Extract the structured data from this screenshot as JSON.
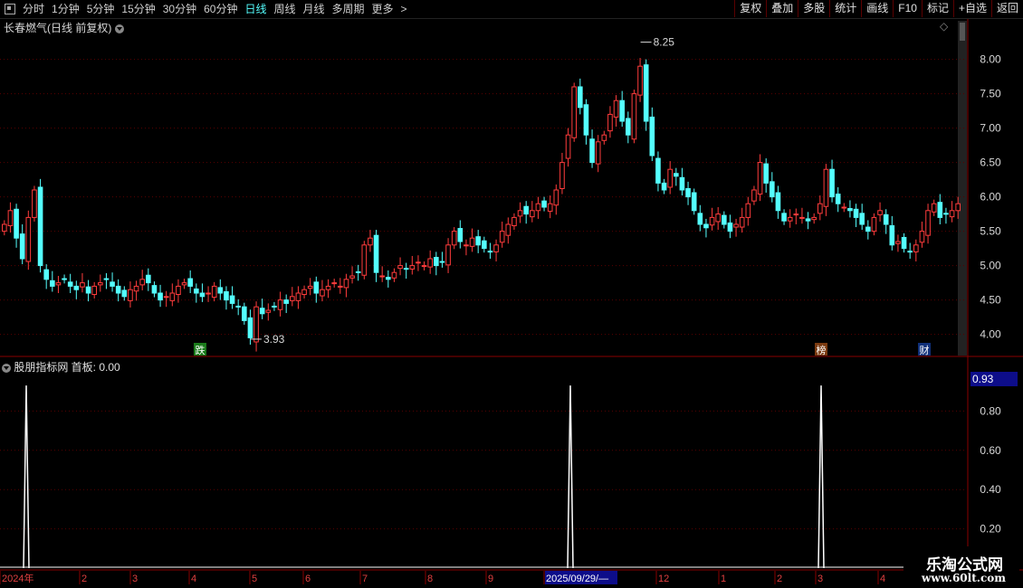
{
  "toolbar": {
    "periods": [
      "分时",
      "1分钟",
      "5分钟",
      "15分钟",
      "30分钟",
      "60分钟",
      "日线",
      "周线",
      "月线",
      "多周期",
      "更多"
    ],
    "active_period": "日线",
    "more_arrow": ">",
    "buttons": [
      "复权",
      "叠加",
      "多股",
      "统计",
      "画线",
      "F10",
      "标记",
      "+自选",
      "返回"
    ]
  },
  "main_panel": {
    "title": "长春燃气(日线 前复权)",
    "diamond_icon": "◇"
  },
  "indicator_panel": {
    "title": "股朋指标网 首板: 0.00",
    "current_axis_value": "0.93"
  },
  "price_axis": {
    "ticks": [
      "8.00",
      "7.50",
      "7.00",
      "6.50",
      "6.00",
      "5.50",
      "5.00",
      "4.50",
      "4.00"
    ]
  },
  "indicator_axis": {
    "ticks": [
      "0.80",
      "0.60",
      "0.40",
      "0.20"
    ]
  },
  "annotations": {
    "high": "8.25",
    "low": "3.93"
  },
  "markers": [
    "跌",
    "榜",
    "财"
  ],
  "time_axis": {
    "labels": [
      "2024年",
      "2",
      "3",
      "4",
      "5",
      "6",
      "7",
      "8",
      "9",
      "2025/09/29/—",
      "12",
      "1",
      "2",
      "3",
      "4"
    ],
    "highlighted": "2025/09/29/—"
  },
  "watermark": {
    "title": "乐淘公式网",
    "url": "www.60lt.com"
  },
  "colors": {
    "up": "#ff3c3c",
    "down": "#54ffff",
    "grid": "#5a0000",
    "signal": "#ffffff",
    "axis_highlight": "#0d0d8a"
  },
  "chart_data": {
    "type": "candlestick",
    "series_type": "close",
    "ylim": [
      3.85,
      8.35
    ],
    "high": 8.25,
    "low": 3.93,
    "closes": [
      5.6,
      5.8,
      5.4,
      5.1,
      5.7,
      6.1,
      5.0,
      4.8,
      4.7,
      4.75,
      4.8,
      4.7,
      4.65,
      4.75,
      4.6,
      4.7,
      4.75,
      4.8,
      4.7,
      4.6,
      4.55,
      4.65,
      4.7,
      4.8,
      4.75,
      4.6,
      4.5,
      4.55,
      4.6,
      4.7,
      4.75,
      4.7,
      4.6,
      4.55,
      4.6,
      4.7,
      4.6,
      4.5,
      4.45,
      4.4,
      4.2,
      3.95,
      4.4,
      4.3,
      4.35,
      4.4,
      4.5,
      4.45,
      4.55,
      4.6,
      4.65,
      4.7,
      4.6,
      4.65,
      4.7,
      4.75,
      4.7,
      4.8,
      4.85,
      4.9,
      5.3,
      5.4,
      4.9,
      4.85,
      4.8,
      4.9,
      5.0,
      4.95,
      5.0,
      5.05,
      5.0,
      5.1,
      5.0,
      5.05,
      5.3,
      5.5,
      5.35,
      5.3,
      5.4,
      5.3,
      5.25,
      5.2,
      5.3,
      5.5,
      5.6,
      5.7,
      5.8,
      5.75,
      5.8,
      5.9,
      5.85,
      5.9,
      6.1,
      6.5,
      6.9,
      7.6,
      7.3,
      6.9,
      6.5,
      6.8,
      6.9,
      7.2,
      7.4,
      7.1,
      6.9,
      7.5,
      7.9,
      7.1,
      6.6,
      6.2,
      6.1,
      6.4,
      6.3,
      6.1,
      6.0,
      5.8,
      5.6,
      5.55,
      5.7,
      5.75,
      5.6,
      5.5,
      5.6,
      5.7,
      5.9,
      6.1,
      6.5,
      6.2,
      6.0,
      5.8,
      5.65,
      5.7,
      5.75,
      5.7,
      5.65,
      5.7,
      5.9,
      6.4,
      6.0,
      5.9,
      5.85,
      5.8,
      5.7,
      5.6,
      5.5,
      5.7,
      5.8,
      5.6,
      5.3,
      5.35,
      5.25,
      5.2,
      5.3,
      5.5,
      5.8,
      5.9,
      5.7,
      5.75,
      5.8,
      5.9
    ],
    "signals": [
      0.93,
      0.93,
      0.93
    ]
  }
}
